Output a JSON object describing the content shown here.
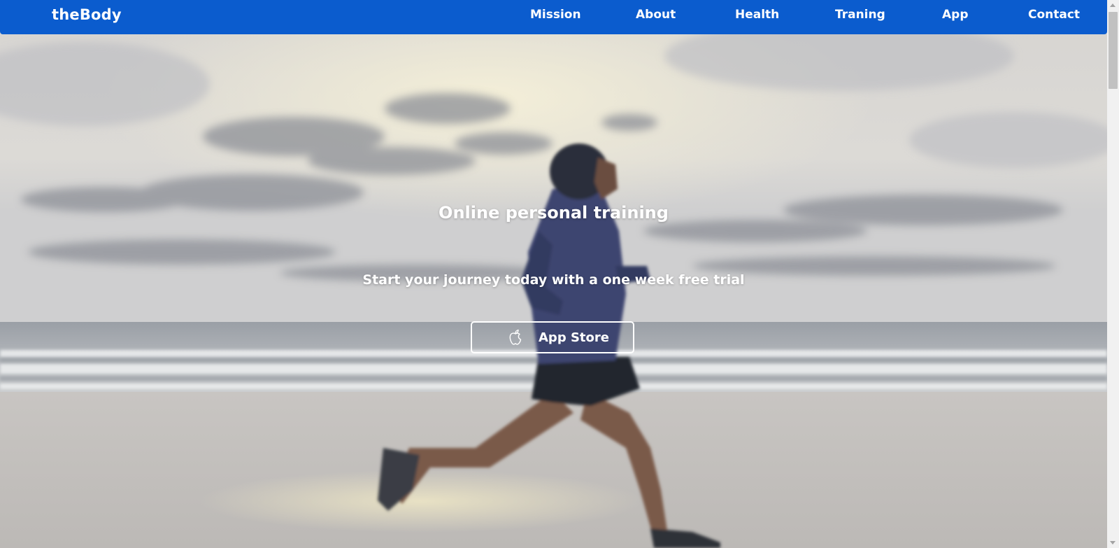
{
  "brand": {
    "name": "theBody"
  },
  "nav": {
    "items": [
      {
        "label": "Mission"
      },
      {
        "label": "About"
      },
      {
        "label": "Health"
      },
      {
        "label": "Traning"
      },
      {
        "label": "App"
      },
      {
        "label": "Contact"
      }
    ]
  },
  "hero": {
    "title": "Online personal training",
    "subtitle": "Start your journey today with a one week free trial",
    "cta": {
      "label": "App Store",
      "icon": "apple-icon"
    }
  },
  "colors": {
    "navbar": "#0b5cce",
    "text": "#ffffff",
    "scrollbar_track": "#f1f1f1",
    "scrollbar_thumb": "#c1c1c1"
  }
}
